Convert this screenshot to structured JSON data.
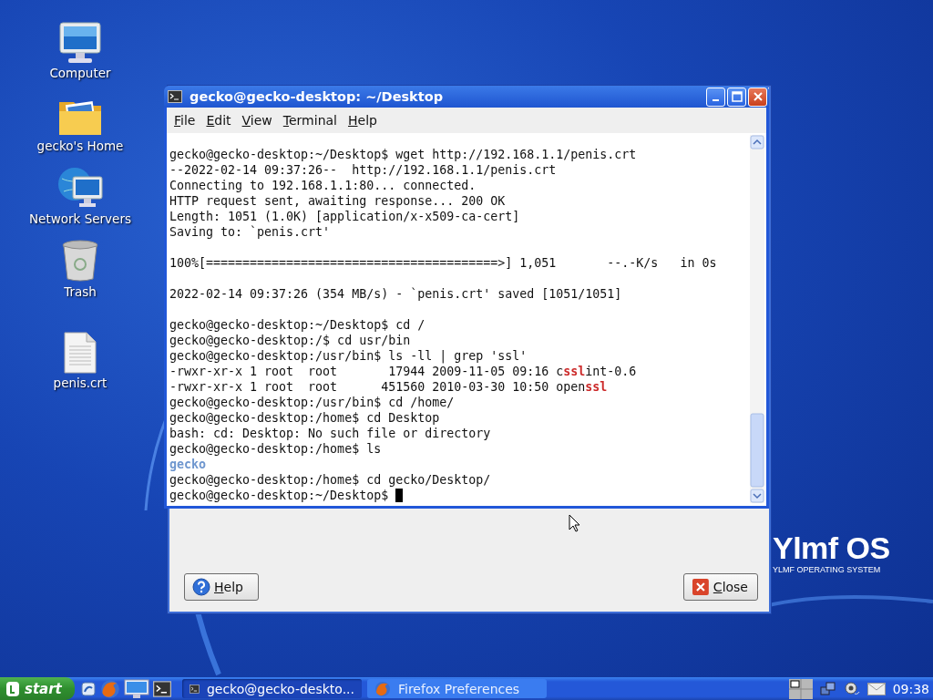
{
  "desktop_icons": [
    {
      "label": "Computer",
      "kind": "computer"
    },
    {
      "label": "gecko's Home",
      "kind": "folder"
    },
    {
      "label": "Network Servers",
      "kind": "network"
    },
    {
      "label": "Trash",
      "kind": "trash"
    },
    {
      "label": "penis.crt",
      "kind": "file"
    }
  ],
  "dialog": {
    "buttons": [
      {
        "label": "Help",
        "kind": "help"
      },
      {
        "label": "Close",
        "kind": "close"
      }
    ]
  },
  "terminal": {
    "title": "gecko@gecko-desktop: ~/Desktop",
    "menu": [
      "File",
      "Edit",
      "View",
      "Terminal",
      "Help"
    ],
    "lines": [
      {
        "kind": "text",
        "text": "gecko@gecko-desktop:~/Desktop$ wget http://192.168.1.1/penis.crt"
      },
      {
        "kind": "text",
        "text": "--2022-02-14 09:37:26--  http://192.168.1.1/penis.crt"
      },
      {
        "kind": "text",
        "text": "Connecting to 192.168.1.1:80... connected."
      },
      {
        "kind": "text",
        "text": "HTTP request sent, awaiting response... 200 OK"
      },
      {
        "kind": "text",
        "text": "Length: 1051 (1.0K) [application/x-x509-ca-cert]"
      },
      {
        "kind": "text",
        "text": "Saving to: `penis.crt'"
      },
      {
        "kind": "blank"
      },
      {
        "kind": "text",
        "text": "100%[========================================>] 1,051       --.-K/s   in 0s"
      },
      {
        "kind": "blank"
      },
      {
        "kind": "text",
        "text": "2022-02-14 09:37:26 (354 MB/s) - `penis.crt' saved [1051/1051]"
      },
      {
        "kind": "blank"
      },
      {
        "kind": "text",
        "text": "gecko@gecko-desktop:~/Desktop$ cd /"
      },
      {
        "kind": "text",
        "text": "gecko@gecko-desktop:/$ cd usr/bin"
      },
      {
        "kind": "text",
        "text": "gecko@gecko-desktop:/usr/bin$ ls -ll | grep 'ssl'"
      },
      {
        "kind": "colored",
        "segments": [
          {
            "text": "-rwxr-xr-x 1 root  root       17944 2009-11-05 09:16 c",
            "kind": "plain"
          },
          {
            "text": "ssl",
            "kind": "match"
          },
          {
            "text": "int-0.6",
            "kind": "plain"
          }
        ]
      },
      {
        "kind": "colored",
        "segments": [
          {
            "text": "-rwxr-xr-x 1 root  root      451560 2010-03-30 10:50 open",
            "kind": "plain"
          },
          {
            "text": "ssl",
            "kind": "match"
          }
        ]
      },
      {
        "kind": "text",
        "text": "gecko@gecko-desktop:/usr/bin$ cd /home/"
      },
      {
        "kind": "text",
        "text": "gecko@gecko-desktop:/home$ cd Desktop"
      },
      {
        "kind": "text",
        "text": "bash: cd: Desktop: No such file or directory"
      },
      {
        "kind": "text",
        "text": "gecko@gecko-desktop:/home$ ls"
      },
      {
        "kind": "colored",
        "segments": [
          {
            "text": "gecko",
            "kind": "dir"
          }
        ]
      },
      {
        "kind": "text",
        "text": "gecko@gecko-desktop:/home$ cd gecko/Desktop/"
      },
      {
        "kind": "text",
        "text": "gecko@gecko-desktop:~/Desktop$ "
      }
    ]
  },
  "logo": {
    "name": "Ylmf OS",
    "tagline": "YLMF OPERATING SYSTEM"
  },
  "taskbar": {
    "start": "start",
    "tasks": [
      {
        "label": "gecko@gecko-deskto...",
        "kind": "terminal",
        "selected": true
      },
      {
        "label": "Firefox Preferences",
        "kind": "browser",
        "selected": false
      }
    ],
    "clock": "09:38"
  }
}
